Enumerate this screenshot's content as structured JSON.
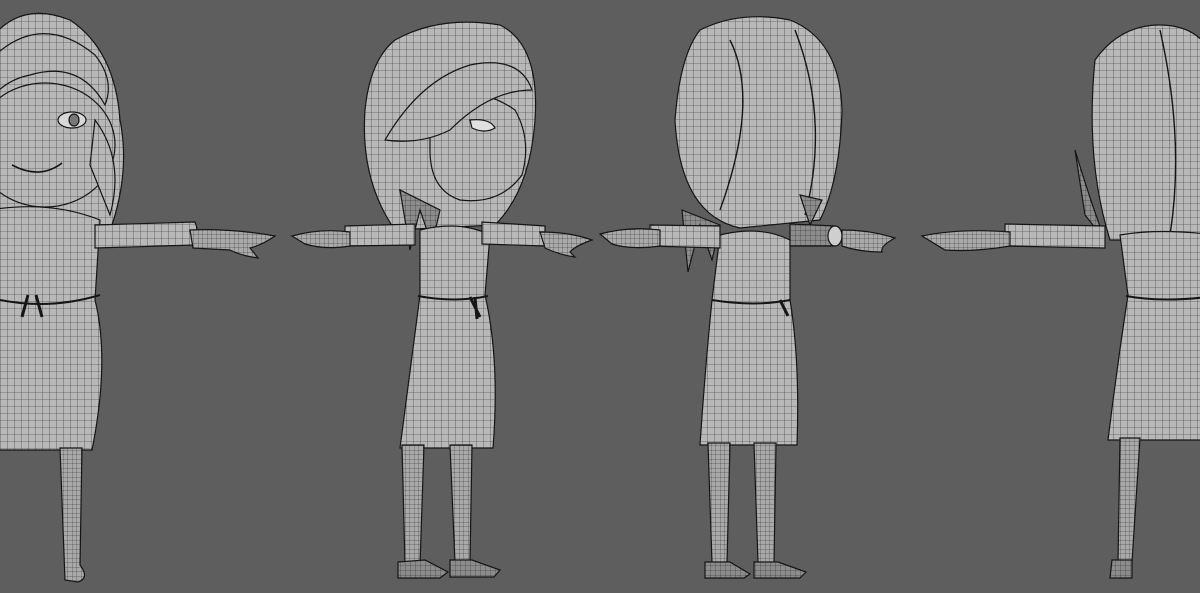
{
  "scene": {
    "background_color": "#5e5e5e",
    "model_shade": "#b8b8b8",
    "model_shade_dark": "#8c8c8c",
    "wire_color": "#2a2a2a",
    "outline_color": "#151515",
    "views": [
      {
        "id": "front",
        "name": "front-view-figure"
      },
      {
        "id": "side",
        "name": "side-view-figure"
      },
      {
        "id": "back",
        "name": "back-view-figure"
      },
      {
        "id": "back-quarter",
        "name": "back-quarter-view-figure"
      }
    ]
  }
}
